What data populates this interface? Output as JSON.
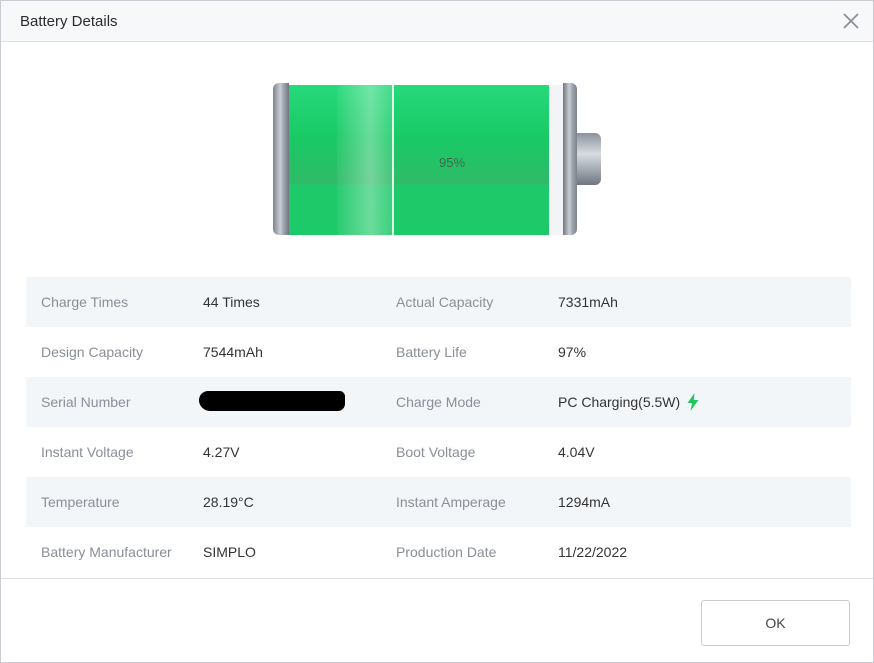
{
  "window": {
    "title": "Battery Details"
  },
  "battery": {
    "percent_label": "95%",
    "fill_fraction": 0.95,
    "fill_color": "#1dc967"
  },
  "rows": [
    {
      "label1": "Charge Times",
      "value1": "44 Times",
      "label2": "Actual Capacity",
      "value2": "7331mAh"
    },
    {
      "label1": "Design Capacity",
      "value1": "7544mAh",
      "label2": "Battery Life",
      "value2": "97%"
    },
    {
      "label1": "Serial Number",
      "value1": "",
      "label2": "Charge Mode",
      "value2": "PC Charging(5.5W)",
      "icon2": "lightning-bolt-icon"
    },
    {
      "label1": "Instant Voltage",
      "value1": "4.27V",
      "label2": "Boot Voltage",
      "value2": "4.04V"
    },
    {
      "label1": "Temperature",
      "value1": "28.19°C",
      "label2": "Instant Amperage",
      "value2": "1294mA"
    },
    {
      "label1": "Battery Manufacturer",
      "value1": "SIMPLO",
      "label2": "Production Date",
      "value2": "11/22/2022"
    }
  ],
  "footer": {
    "ok_label": "OK"
  },
  "colors": {
    "accent_green": "#1dc967",
    "bolt": "#22c55e"
  },
  "icons": {
    "close": "close-icon"
  }
}
